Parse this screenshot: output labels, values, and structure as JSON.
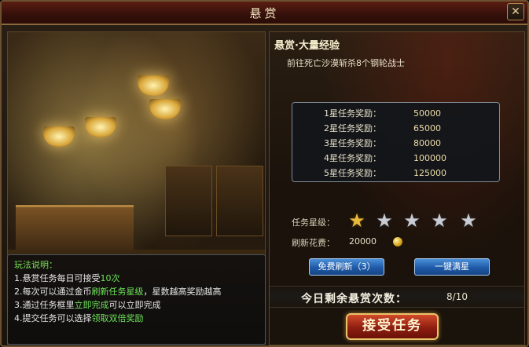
{
  "window": {
    "title": "悬赏",
    "close_glyph": "✕"
  },
  "quest": {
    "title": "悬赏·大量经验",
    "description": "前往死亡沙漠斩杀8个钢轮战士"
  },
  "rewards": [
    {
      "label": "1星任务奖励：",
      "value": "50000"
    },
    {
      "label": "2星任务奖励：",
      "value": "65000"
    },
    {
      "label": "3星任务奖励：",
      "value": "80000"
    },
    {
      "label": "4星任务奖励：",
      "value": "100000"
    },
    {
      "label": "5星任务奖励：",
      "value": "125000"
    }
  ],
  "stars": {
    "label": "任务星级：",
    "current": 1,
    "max": 5
  },
  "refresh": {
    "label": "刷新花费：",
    "cost": "20000",
    "icon": "gold-coin-icon"
  },
  "buttons": {
    "free_refresh": "免费刷新（3）",
    "max_star": "一键满星",
    "accept": "接受任务"
  },
  "remaining": {
    "label": "今日剩余悬赏次数：",
    "value": "8/10"
  },
  "rules": {
    "title": "玩法说明：",
    "line1_a": "1.悬赏任务每日可接受",
    "line1_b": "10次",
    "line2_a": "2.每次可以通过金币",
    "line2_b": "刷新任务星级",
    "line2_c": "，星数越高奖励越高",
    "line3_a": "3.通过任务框里",
    "line3_b": "立即完成",
    "line3_c": "可以立即完成",
    "line4_a": "4.提交任务可以选择",
    "line4_b": "领取双倍奖励"
  },
  "colors": {
    "accent_green": "#6ee35a",
    "star_gold": "#e8b93a",
    "button_blue": "#1f5aa8",
    "accept_red": "#8e1e10"
  }
}
